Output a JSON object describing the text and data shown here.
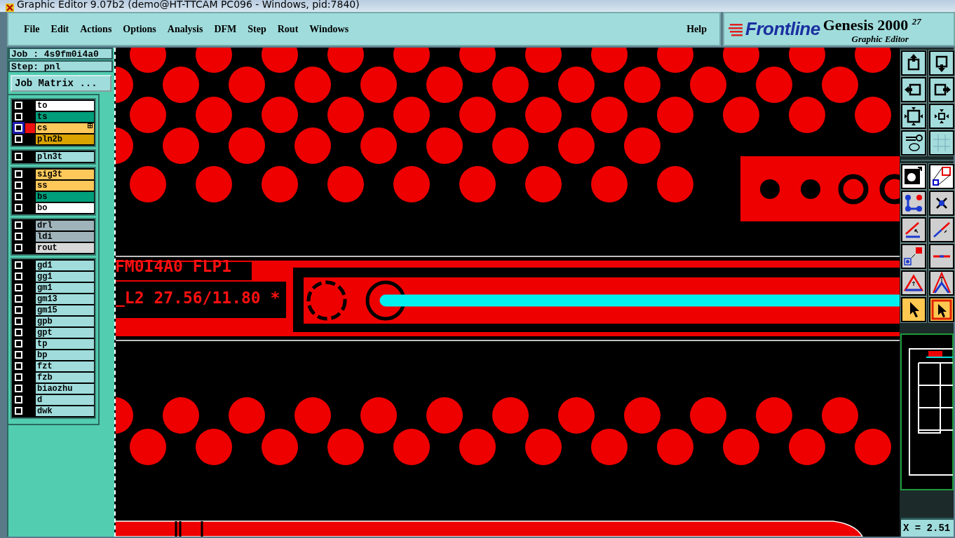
{
  "window": {
    "title": "Graphic Editor 9.07b2 (demo@HT-TTCAM PC096 - Windows, pid:7840)"
  },
  "menu": [
    "File",
    "Edit",
    "Actions",
    "Options",
    "Analysis",
    "DFM",
    "Step",
    "Rout",
    "Windows"
  ],
  "help": "Help",
  "brand": {
    "logo": "Frontline",
    "product": "Genesis 2000 $^{27}$",
    "subtitle": "Graphic Editor"
  },
  "job": {
    "job_label": "Job : 4s9fm0i4a0",
    "step_label": "Step: pnl",
    "matrix_button": "Job Matrix ..."
  },
  "layer_groups": [
    {
      "layers": [
        {
          "name": "to",
          "color": "#ffffff",
          "checked": false,
          "selected": false
        },
        {
          "name": "ts",
          "color": "#009e7a",
          "checked": false,
          "selected": false
        },
        {
          "name": "cs",
          "color": "#ffc85a",
          "checked": false,
          "selected": true
        },
        {
          "name": "pln2b",
          "color": "#d9a300",
          "checked": false,
          "selected": false
        }
      ]
    },
    {
      "layers": [
        {
          "name": "pln3t",
          "color": "#a0dcdc",
          "checked": false,
          "selected": false
        }
      ]
    },
    {
      "layers": [
        {
          "name": "sig3t",
          "color": "#ffc85a",
          "checked": false,
          "selected": false
        },
        {
          "name": "ss",
          "color": "#ffc85a",
          "checked": false,
          "selected": false
        },
        {
          "name": "bs",
          "color": "#009e7a",
          "checked": false,
          "selected": false
        },
        {
          "name": "bo",
          "color": "#ffffff",
          "checked": false,
          "selected": false
        }
      ]
    },
    {
      "layers": [
        {
          "name": "drl",
          "color": "#9fb3bb",
          "checked": false,
          "selected": false
        },
        {
          "name": "ldi",
          "color": "#9fb3bb",
          "checked": false,
          "selected": false
        },
        {
          "name": "rout",
          "color": "#d8d8d8",
          "checked": false,
          "selected": false
        }
      ]
    },
    {
      "layers": [
        {
          "name": "gd1",
          "color": "#a0dcdc",
          "checked": false,
          "selected": false
        },
        {
          "name": "gg1",
          "color": "#a0dcdc",
          "checked": false,
          "selected": false
        },
        {
          "name": "gm1",
          "color": "#a0dcdc",
          "checked": false,
          "selected": false
        },
        {
          "name": "gm13",
          "color": "#a0dcdc",
          "checked": false,
          "selected": false
        },
        {
          "name": "gm15",
          "color": "#a0dcdc",
          "checked": false,
          "selected": false
        },
        {
          "name": "gpb",
          "color": "#a0dcdc",
          "checked": false,
          "selected": false
        },
        {
          "name": "gpt",
          "color": "#a0dcdc",
          "checked": false,
          "selected": false
        },
        {
          "name": "tp",
          "color": "#a0dcdc",
          "checked": false,
          "selected": false
        },
        {
          "name": "bp",
          "color": "#a0dcdc",
          "checked": false,
          "selected": false
        },
        {
          "name": "fzt",
          "color": "#a0dcdc",
          "checked": false,
          "selected": false
        },
        {
          "name": "fzb",
          "color": "#a0dcdc",
          "checked": false,
          "selected": false
        },
        {
          "name": "biaozhu",
          "color": "#a0dcdc",
          "checked": false,
          "selected": false
        },
        {
          "name": "d",
          "color": "#a0dcdc",
          "checked": false,
          "selected": false
        },
        {
          "name": "dwk",
          "color": "#a0dcdc",
          "checked": false,
          "selected": false
        }
      ]
    }
  ],
  "canvas_texts": [
    "FM0I4A0 FLP1",
    "_L2 27.56/11.80 *"
  ],
  "toolbar": [
    {
      "kind": "pan-up"
    },
    {
      "kind": "pan-down"
    },
    {
      "kind": "pan-left"
    },
    {
      "kind": "pan-right"
    },
    {
      "kind": "zoom-out"
    },
    {
      "kind": "zoom-in"
    },
    {
      "kind": "tools"
    },
    {
      "kind": "grid"
    },
    {
      "kind": "feature"
    },
    {
      "kind": "area"
    },
    {
      "kind": "nodes"
    },
    {
      "kind": "point"
    },
    {
      "kind": "line"
    },
    {
      "kind": "line-dir"
    },
    {
      "kind": "pad-move"
    },
    {
      "kind": "segment"
    },
    {
      "kind": "triangle"
    },
    {
      "kind": "peak"
    },
    {
      "kind": "select"
    },
    {
      "kind": "select-box"
    }
  ],
  "status": {
    "coordinate": "X = 2.51"
  }
}
